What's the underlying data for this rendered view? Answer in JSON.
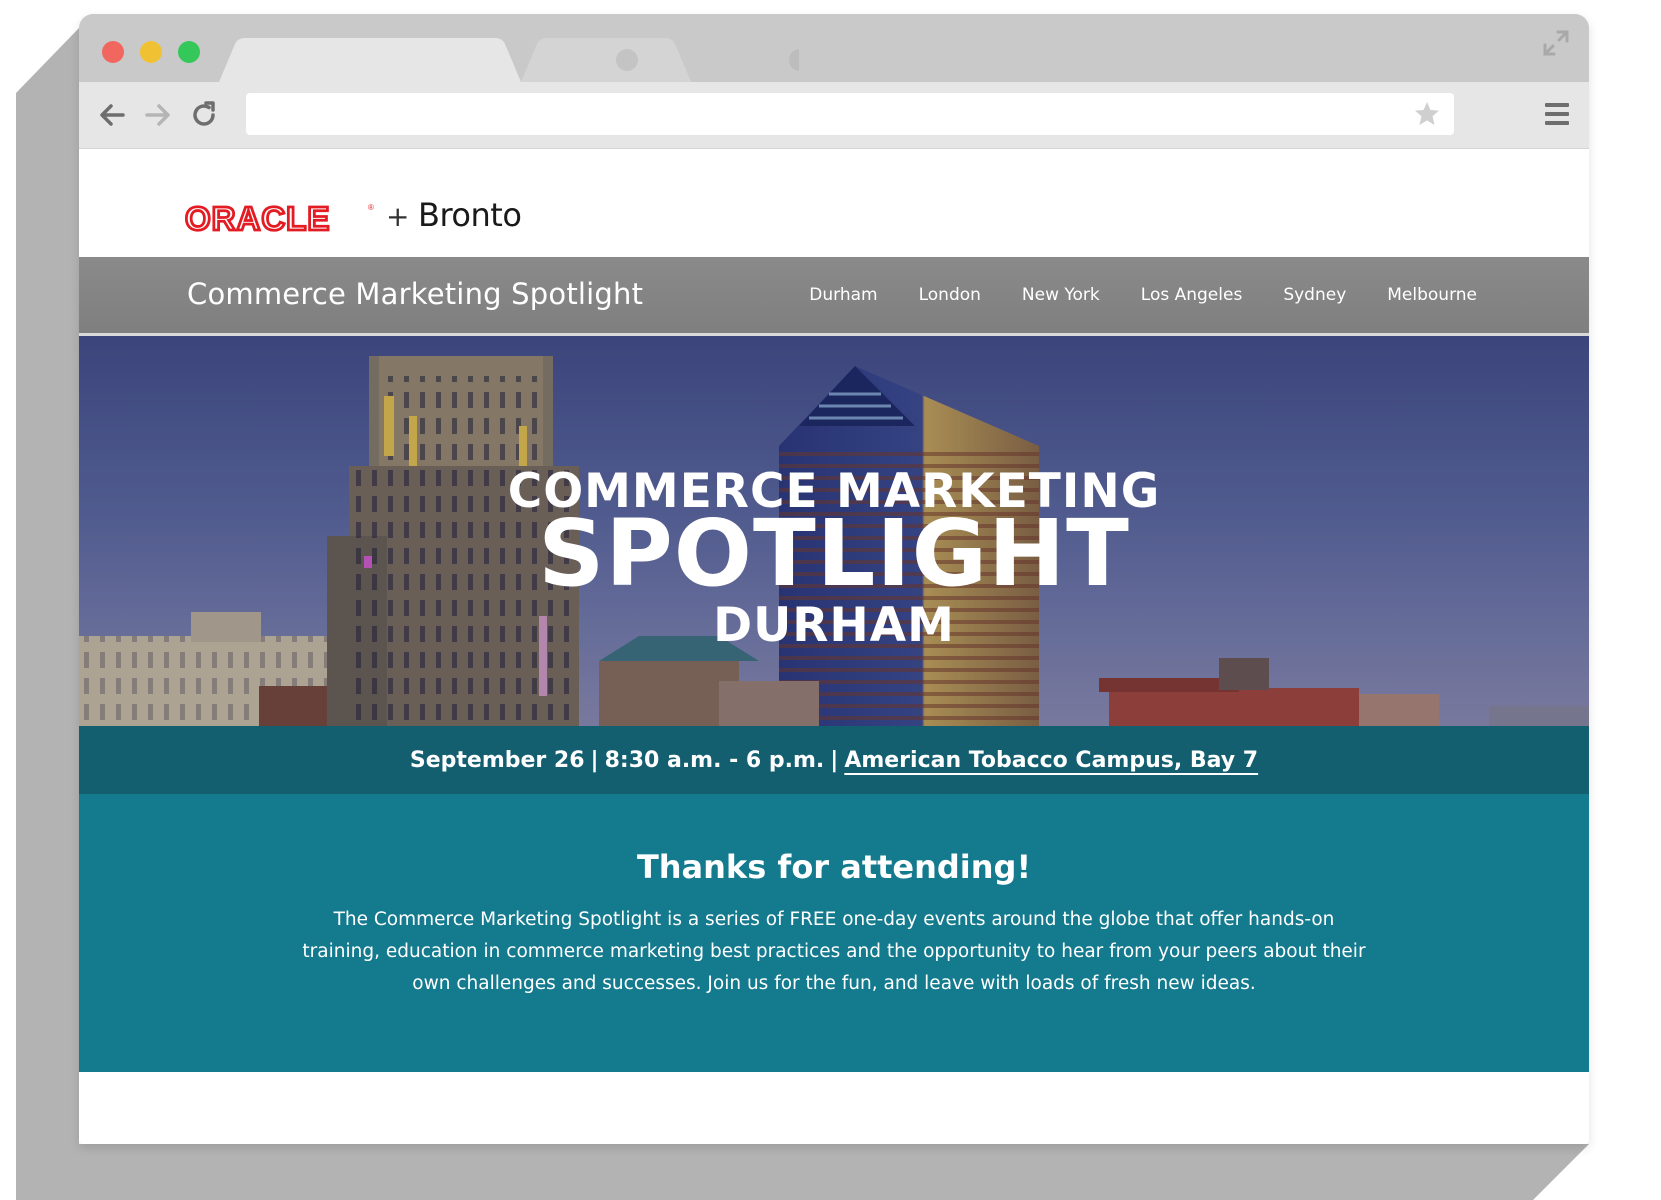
{
  "browser": {
    "tabs": [
      {
        "label": ""
      },
      {
        "label": ""
      }
    ],
    "url": "",
    "colors": {
      "red": "#f1665e",
      "yellow": "#f0c233",
      "green": "#34c85a"
    }
  },
  "header": {
    "logo_oracle": "ORACLE",
    "plus": "+",
    "logo_bronto": "Bronto"
  },
  "nav": {
    "title": "Commerce Marketing Spotlight",
    "links": [
      "Durham",
      "London",
      "New York",
      "Los Angeles",
      "Sydney",
      "Melbourne"
    ]
  },
  "hero": {
    "line1": "COMMERCE MARKETING",
    "line2": "SPOTLIGHT",
    "line3": "DURHAM"
  },
  "event": {
    "date": "September 26",
    "time": "8:30 a.m. - 6 p.m.",
    "separator": "|",
    "venue": "American Tobacco Campus, Bay 7"
  },
  "thanks": {
    "heading": "Thanks for attending!",
    "body": "The Commerce Marketing Spotlight is a series of FREE one-day events around the globe that offer hands-on training, education in commerce marketing best practices and the opportunity to hear from your peers about their own challenges and successes. Join us for the fun, and leave with loads of fresh new ideas."
  },
  "icons": {
    "back": "back-arrow-icon",
    "forward": "forward-arrow-icon",
    "reload": "reload-icon",
    "star": "star-icon",
    "menu": "hamburger-menu-icon",
    "expand": "expand-icon"
  },
  "theme": {
    "oracle_red": "#e31b23",
    "nav_gray": "#878787",
    "event_bar": "#135f70",
    "thanks_bg": "#147a8e"
  }
}
